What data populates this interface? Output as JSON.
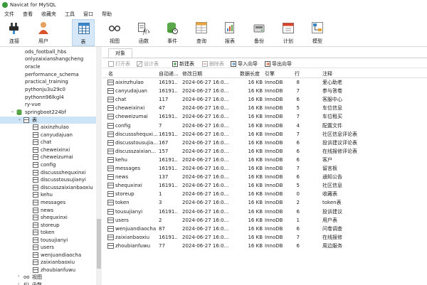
{
  "app": {
    "title": "Navicat for MySQL"
  },
  "menu": [
    "文件",
    "查看",
    "收藏夹",
    "工具",
    "窗口",
    "帮助"
  ],
  "toolbar": {
    "items": [
      {
        "label": "连接",
        "icon": "plug-icon"
      },
      {
        "label": "用户",
        "icon": "user-icon"
      },
      {
        "label": "表",
        "icon": "table-icon"
      },
      {
        "label": "视图",
        "icon": "glasses-icon"
      },
      {
        "label": "函数",
        "icon": "function-icon"
      },
      {
        "label": "事件",
        "icon": "database-clock-icon"
      },
      {
        "label": "查询",
        "icon": "query-grid-icon"
      },
      {
        "label": "报表",
        "icon": "report-icon"
      },
      {
        "label": "备份",
        "icon": "backup-icon"
      },
      {
        "label": "计划",
        "icon": "calendar-icon"
      },
      {
        "label": "模型",
        "icon": "model-icon"
      }
    ],
    "active": "表"
  },
  "sidebar": {
    "databases_above": [
      "ods_football_hbs",
      "onlyzaixianshangcheng",
      "oracle",
      "performance_schema",
      "practical_training",
      "pythonju3u29c0",
      "pythonn96lkgl4",
      "ry-vue"
    ],
    "open_database": "springboot224bf",
    "tables_node": "表",
    "tables": [
      "aixinzhulao",
      "canyudajuan",
      "chat",
      "cheweixinxi",
      "cheweizumai",
      "config",
      "discussshequxinxi",
      "discusstousujianyi",
      "discusszaixianbaoxiu",
      "kehu",
      "messages",
      "news",
      "shequxinxi",
      "storeup",
      "token",
      "tousujianyi",
      "users",
      "wenjuandiaocha",
      "zaixianbaoxiu",
      "zhoubianfuwu"
    ],
    "views_node": "视图",
    "functions_node": "函数"
  },
  "main": {
    "tab": "对象",
    "actions": [
      {
        "label": "打开表",
        "enabled": false
      },
      {
        "label": "设计表",
        "enabled": false
      },
      {
        "label": "新建表",
        "enabled": true
      },
      {
        "label": "删除表",
        "enabled": false
      },
      {
        "label": "导入向导",
        "enabled": true
      },
      {
        "label": "导出向导",
        "enabled": true
      }
    ],
    "columns": [
      "名",
      "自动递...",
      "修改日期",
      "数据长度",
      "引擎",
      "行",
      "注释"
    ],
    "rows": [
      [
        "aixinzhulao",
        "16191...",
        "2024-06-27 16:0...",
        "16 KB",
        "InnoDB",
        "8",
        "爱心助老"
      ],
      [
        "canyudajuan",
        "16191...",
        "2024-06-27 16:0...",
        "16 KB",
        "InnoDB",
        "7",
        "参与答卷"
      ],
      [
        "chat",
        "117",
        "2024-06-27 16:0...",
        "16 KB",
        "InnoDB",
        "6",
        "客服中心"
      ],
      [
        "cheweixinxi",
        "47",
        "2024-06-27 16:0...",
        "16 KB",
        "InnoDB",
        "5",
        "车位信息"
      ],
      [
        "cheweizumai",
        "16191...",
        "2024-06-27 16:0...",
        "16 KB",
        "InnoDB",
        "7",
        "车位租买"
      ],
      [
        "config",
        "7",
        "2024-06-27 16:0...",
        "16 KB",
        "InnoDB",
        "4",
        "配置文件"
      ],
      [
        "discussshequxi...",
        "16191...",
        "2024-06-27 16:0...",
        "16 KB",
        "InnoDB",
        "7",
        "社区信息评论表"
      ],
      [
        "discusstousujia...",
        "167",
        "2024-06-27 16:0...",
        "16 KB",
        "InnoDB",
        "6",
        "投诉建议评论表"
      ],
      [
        "discusszaixian...",
        "157",
        "2024-06-27 16:0...",
        "16 KB",
        "InnoDB",
        "6",
        "在线报修评论表"
      ],
      [
        "kehu",
        "16191...",
        "2024-06-27 16:0...",
        "16 KB",
        "InnoDB",
        "6",
        "客户"
      ],
      [
        "messages",
        "16191...",
        "2024-06-27 16:0...",
        "16 KB",
        "InnoDB",
        "7",
        "留言板"
      ],
      [
        "news",
        "137",
        "2024-06-27 16:0...",
        "16 KB",
        "InnoDB",
        "6",
        "通知公告"
      ],
      [
        "shequxinxi",
        "16191...",
        "2024-06-27 16:0...",
        "16 KB",
        "InnoDB",
        "5",
        "社区信息"
      ],
      [
        "storeup",
        "1",
        "2024-06-27 16:0...",
        "16 KB",
        "InnoDB",
        "0",
        "收藏表"
      ],
      [
        "token",
        "3",
        "2024-06-27 16:0...",
        "16 KB",
        "InnoDB",
        "2",
        "token表"
      ],
      [
        "tousujianyi",
        "16191...",
        "2024-06-27 16:0...",
        "16 KB",
        "InnoDB",
        "6",
        "投诉建议"
      ],
      [
        "users",
        "2",
        "2024-06-27 16:0...",
        "16 KB",
        "InnoDB",
        "1",
        "用户表"
      ],
      [
        "wenjuandiaocha",
        "87",
        "2024-06-27 16:0...",
        "16 KB",
        "InnoDB",
        "6",
        "问卷调查"
      ],
      [
        "zaixianbaoxiu",
        "16191...",
        "2024-06-27 16:0...",
        "16 KB",
        "InnoDB",
        "7",
        "在线报修"
      ],
      [
        "zhoubianfuwu",
        "77",
        "2024-06-27 16:0...",
        "16 KB",
        "InnoDB",
        "6",
        "周边服务"
      ]
    ]
  }
}
